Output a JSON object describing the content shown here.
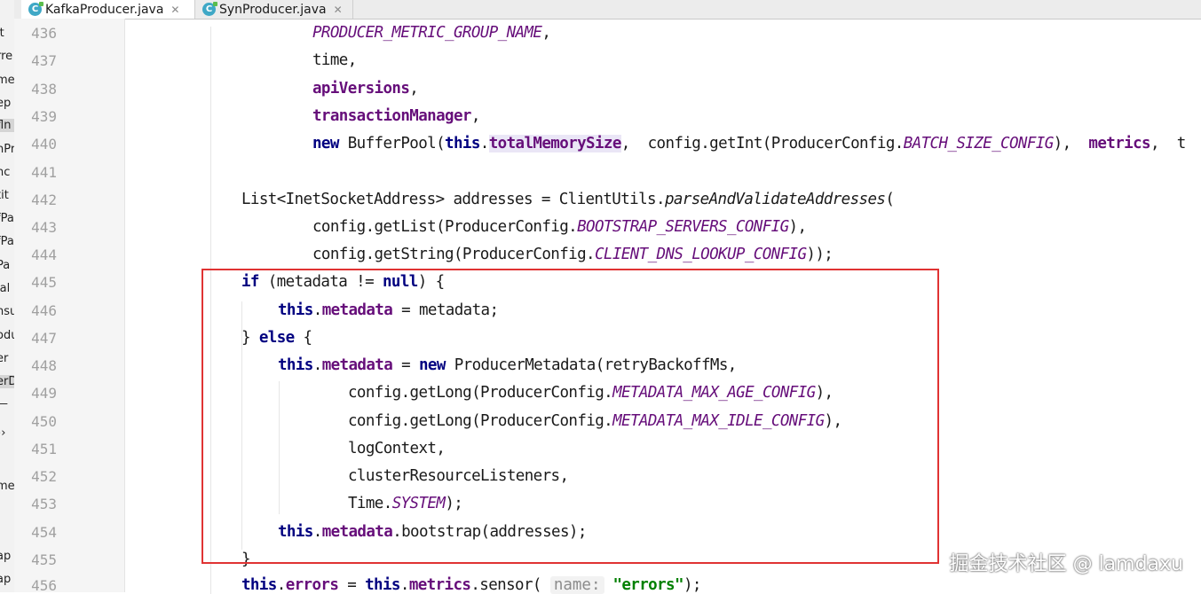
{
  "tabs": [
    {
      "name": "KafkaProducer.java",
      "active": true
    },
    {
      "name": "SynProducer.java",
      "active": false
    }
  ],
  "project_fragments": [
    "it",
    "rre",
    "me",
    "ep",
    "fln",
    "nPr",
    "nc",
    "tit",
    "fPa",
    "fPa",
    "Pa",
    "ial",
    "nsu",
    "odu",
    "er",
    "erD",
    "—",
    "››",
    "me",
    "ap",
    "ap"
  ],
  "line_numbers": [
    "436",
    "437",
    "438",
    "439",
    "440",
    "441",
    "442",
    "443",
    "444",
    "445",
    "446",
    "447",
    "448",
    "449",
    "450",
    "451",
    "452",
    "453",
    "454",
    "455",
    "456"
  ],
  "code": {
    "l436_const": "PRODUCER_METRIC_GROUP_NAME",
    "l436_tail": ",",
    "l437": "time,",
    "l438_field": "apiVersions",
    "l438_tail": ",",
    "l439_field": "transactionManager",
    "l439_tail": ",",
    "l440_new": "new",
    "l440_a": " BufferPool(",
    "l440_this": "this",
    "l440_dot": ".",
    "l440_field": "totalMemorySize",
    "l440_b": ",  config.getInt(ProducerConfig.",
    "l440_const": "BATCH_SIZE_CONFIG",
    "l440_c": "),  ",
    "l440_metrics": "metrics",
    "l440_d": ",  t",
    "l442_a": "List<InetSocketAddress> addresses = ClientUtils.",
    "l442_static": "parseAndValidateAddresses",
    "l442_b": "(",
    "l443_a": "config.getList(ProducerConfig.",
    "l443_const": "BOOTSTRAP_SERVERS_CONFIG",
    "l443_b": "),",
    "l444_a": "config.getString(ProducerConfig.",
    "l444_const": "CLIENT_DNS_LOOKUP_CONFIG",
    "l444_b": "));",
    "l445_if": "if",
    "l445_a": " (metadata != ",
    "l445_null": "null",
    "l445_b": ") {",
    "l446_this": "this",
    "l446_dot": ".",
    "l446_field": "metadata",
    "l446_a": " = metadata;",
    "l447_a": "} ",
    "l447_else": "else",
    "l447_b": " {",
    "l448_this": "this",
    "l448_dot": ".",
    "l448_field": "metadata",
    "l448_a": " = ",
    "l448_new": "new",
    "l448_b": " ProducerMetadata(retryBackoffMs,",
    "l449_a": "config.getLong(ProducerConfig.",
    "l449_const": "METADATA_MAX_AGE_CONFIG",
    "l449_b": "),",
    "l450_a": "config.getLong(ProducerConfig.",
    "l450_const": "METADATA_MAX_IDLE_CONFIG",
    "l450_b": "),",
    "l451": "logContext,",
    "l452": "clusterResourceListeners,",
    "l453_a": "Time.",
    "l453_const": "SYSTEM",
    "l453_b": ");",
    "l454_this": "this",
    "l454_dot": ".",
    "l454_field": "metadata",
    "l454_a": ".bootstrap(addresses);",
    "l455": "}",
    "l456_this": "this",
    "l456_dot": ".",
    "l456_field": "errors",
    "l456_a": " = ",
    "l456_this2": "this",
    "l456_dot2": ".",
    "l456_field2": "metrics",
    "l456_b": ".sensor( ",
    "l456_hint": "name:",
    "l456_c": " ",
    "l456_str": "\"errors\"",
    "l456_d": ");"
  },
  "watermark": "掘金技术社区 @ lamdaxu",
  "colors": {
    "keyword": "#000080",
    "field": "#660e7a",
    "string": "#008000",
    "highlight_box": "#e03333"
  }
}
